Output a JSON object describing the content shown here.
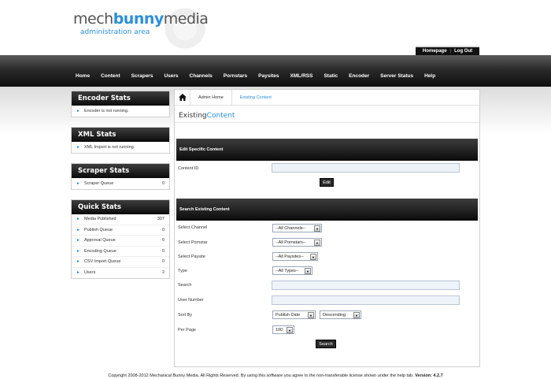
{
  "logo": {
    "part1": "mech",
    "part2": "bunny",
    "part3": "media",
    "subtitle": "administration area"
  },
  "top_links": {
    "homepage": "Homepage",
    "separator": "|",
    "logout": "Log Out"
  },
  "nav": [
    "Home",
    "Content",
    "Scrapers",
    "Users",
    "Channels",
    "Pornstars",
    "Paysites",
    "XML/RSS",
    "Static",
    "Encoder",
    "Server Status",
    "Help"
  ],
  "sidebar": {
    "encoder": {
      "title": "Encoder Stats",
      "text": "Encoder is not running."
    },
    "xml": {
      "title": "XML Stats",
      "text": "XML Import is not running."
    },
    "scraper": {
      "title": "Scraper Stats",
      "label": "Scraper Queue",
      "value": "0"
    },
    "quick": {
      "title": "Quick Stats",
      "rows": [
        {
          "label": "Media Published",
          "value": "307"
        },
        {
          "label": "Publish Queue",
          "value": "0"
        },
        {
          "label": "Approval Queue",
          "value": "0"
        },
        {
          "label": "Encoding Queue",
          "value": "0"
        },
        {
          "label": "CSV Import Queue",
          "value": "0"
        },
        {
          "label": "Users",
          "value": "2"
        }
      ]
    }
  },
  "breadcrumb": {
    "item1": "Admin Home",
    "item2": "Existing Content"
  },
  "page_title": {
    "part1": "Existing",
    "part2": "Content"
  },
  "edit_section": {
    "title": "Edit Specific Content",
    "content_id_label": "Content ID",
    "content_id_value": "",
    "edit_button": "Edit"
  },
  "search_section": {
    "title": "Search Existing Content",
    "channel": {
      "label": "Select Channel",
      "value": "--All Channels--"
    },
    "pornstar": {
      "label": "Select Pornstar",
      "value": "--All Pornstars--"
    },
    "paysite": {
      "label": "Select Paysite",
      "value": "--All Paysites--"
    },
    "type": {
      "label": "Type",
      "value": "--All Types--"
    },
    "search": {
      "label": "Search",
      "value": ""
    },
    "user_number": {
      "label": "User Number",
      "value": ""
    },
    "sort_by": {
      "label": "Sort By",
      "field": "Publish Date",
      "order": "Descending"
    },
    "per_page": {
      "label": "Per Page",
      "value": "100"
    },
    "search_button": "Search"
  },
  "footer": {
    "text": "Copyright 2008-2012 Mechanical Bunny Media. All Rights Reserved. By using this software you agree to the non-transferable license shown under the help tab.",
    "version": "Version: 4.2.7"
  },
  "colors": {
    "accent": "#2b8fd8",
    "bar_dark": "#0b0b0b"
  },
  "icons": [
    "home-icon",
    "arrow-icon",
    "dropdown-arrow-icon"
  ]
}
